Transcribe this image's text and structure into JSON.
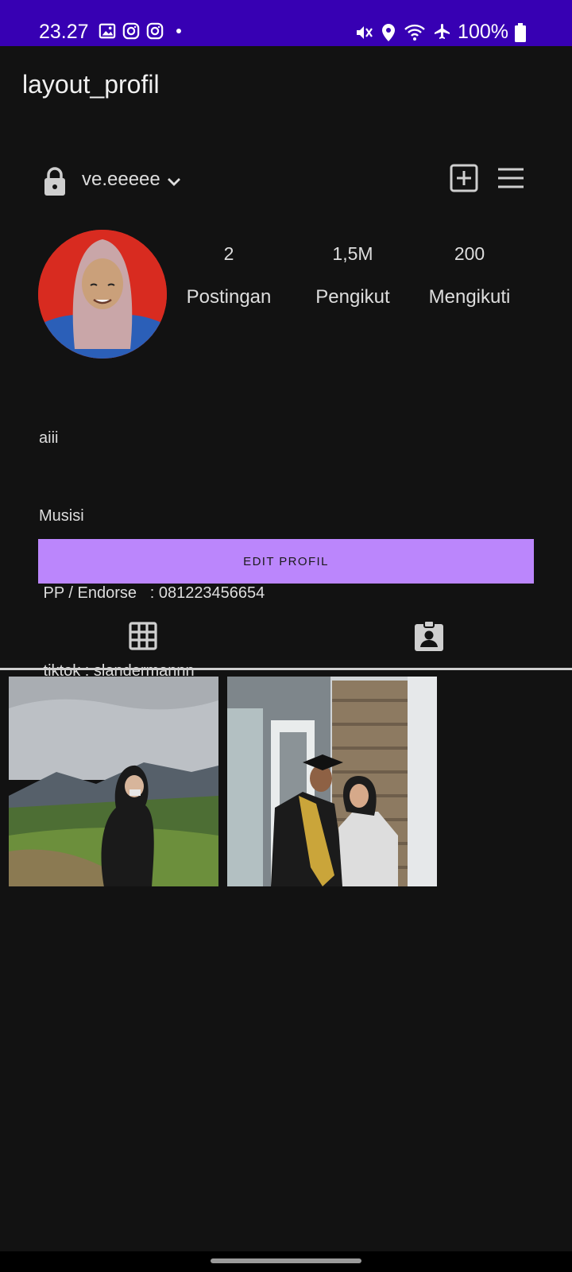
{
  "status_bar": {
    "time": "23.27",
    "battery": "100%",
    "left_icons": [
      "image-icon",
      "instagram-icon",
      "instagram-icon",
      "dot-icon"
    ],
    "right_icons": [
      "mute-icon",
      "location-icon",
      "wifi-icon",
      "airplane-icon",
      "battery-icon"
    ],
    "color": "#3700b3"
  },
  "app_bar": {
    "title": "layout_profil"
  },
  "profile": {
    "username": "ve.eeeee",
    "stats": [
      {
        "value": "2",
        "label": "Postingan"
      },
      {
        "value": "1,5M",
        "label": "Pengikut"
      },
      {
        "value": "200",
        "label": "Mengikuti"
      }
    ],
    "bio_lines": [
      "aiii",
      "Musisi",
      " PP / Endorse   : 081223456654",
      " tiktok : slandermannn"
    ]
  },
  "edit_button": {
    "label": "EDIT PROFIL",
    "color": "#bb86fc"
  },
  "tabs": [
    {
      "icon": "grid-icon"
    },
    {
      "icon": "tagged-person-icon"
    }
  ],
  "posts": [
    {
      "alt": "photo-mountain-field"
    },
    {
      "alt": "photo-graduation"
    }
  ]
}
